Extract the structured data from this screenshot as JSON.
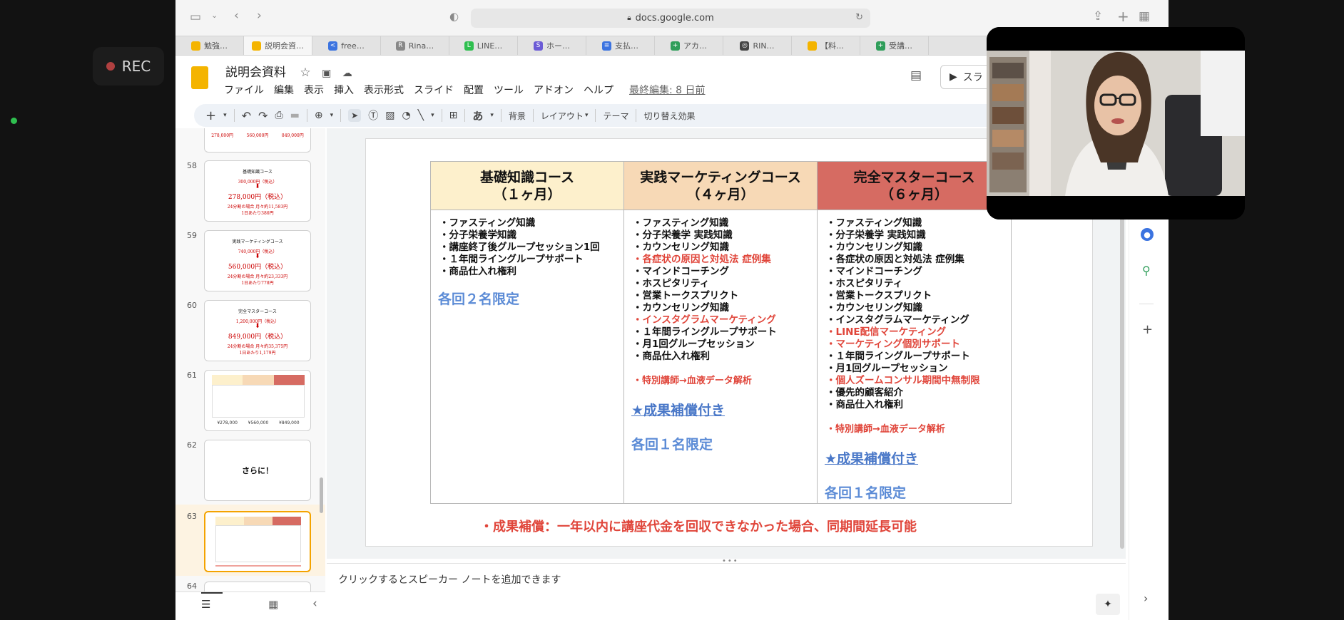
{
  "recording": {
    "label": "REC"
  },
  "browser": {
    "url": "docs.google.com",
    "tabs": [
      {
        "label": "勉強…",
        "color": "#f4b400",
        "icon": ""
      },
      {
        "label": "説明会資…",
        "color": "#f4b400",
        "icon": ""
      },
      {
        "label": "free…",
        "color": "#3b73e0",
        "icon": "<"
      },
      {
        "label": "Rina…",
        "color": "#888888",
        "icon": "R"
      },
      {
        "label": "LINE…",
        "color": "#2fbf4f",
        "icon": "L"
      },
      {
        "label": "ホー…",
        "color": "#6b5bd6",
        "icon": "S"
      },
      {
        "label": "支払…",
        "color": "#3b73e0",
        "icon": "≡"
      },
      {
        "label": "アカ…",
        "color": "#2f9e5a",
        "icon": "+"
      },
      {
        "label": "RIN…",
        "color": "#444444",
        "icon": "◎"
      },
      {
        "label": "【料…",
        "color": "#f4b400",
        "icon": ""
      },
      {
        "label": "受講…",
        "color": "#2f9e5a",
        "icon": "+"
      }
    ]
  },
  "slides": {
    "title": "説明会資料",
    "menu": [
      "ファイル",
      "編集",
      "表示",
      "挿入",
      "表示形式",
      "スライド",
      "配置",
      "ツール",
      "アドオン",
      "ヘルプ"
    ],
    "last_edit": "最終編集: 8 日前",
    "toolbar": {
      "bg": "背景",
      "layout": "レイアウト",
      "theme": "テーマ",
      "transition": "切り替え効果",
      "font_glyph": "あ"
    },
    "present_label": "スラ",
    "notes_placeholder": "クリックするとスピーカー ノートを追加できます"
  },
  "filmstrip": {
    "numbers": [
      "58",
      "59",
      "60",
      "61",
      "62",
      "63",
      "64"
    ],
    "thumb57": {
      "l1": "278,000円",
      "l2": "560,000円",
      "l3": "849,000円"
    },
    "thumb58": {
      "t": "基礎知識コース",
      "a": "300,000円（税込）",
      "b": "278,000円（税込）",
      "c": "24分割の場合 月々約11,583円",
      "d": "1日あたり386円"
    },
    "thumb59": {
      "t": "実践マーケティングコース",
      "a": "740,000円（税込）",
      "b": "560,000円（税込）",
      "c": "24分割の場合 月々約23,333円",
      "d": "1日あたり778円"
    },
    "thumb60": {
      "t": "完全マスターコース",
      "a": "1,200,000円（税込）",
      "b": "849,000円（税込）",
      "c": "24分割の場合 月々約35,375円",
      "d": "1日あたり1,179円"
    },
    "thumb61": {
      "p1": "¥278,000",
      "p2": "¥560,000",
      "p3": "¥849,000"
    },
    "thumb62": {
      "text": "さらに！"
    }
  },
  "slide": {
    "columns": [
      {
        "title": "基礎知識コース",
        "subtitle": "（１ヶ月）",
        "color": "#fdf0cc",
        "items": [
          {
            "text": "・ファスティング知識",
            "red": false
          },
          {
            "text": "・分子栄養学知識",
            "red": false
          },
          {
            "text": "・講座終了後グループセッション1回",
            "red": false
          },
          {
            "text": "・１年間ライングループサポート",
            "red": false
          },
          {
            "text": "・商品仕入れ権利",
            "red": false
          }
        ],
        "guarantee": "",
        "limit": "各回２名限定"
      },
      {
        "title": "実践マーケティングコース",
        "subtitle": "（４ヶ月）",
        "color": "#f7d9b6",
        "items": [
          {
            "text": "・ファスティング知識",
            "red": false
          },
          {
            "text": "・分子栄養学 実践知識",
            "red": false
          },
          {
            "text": "・カウンセリング知識",
            "red": false
          },
          {
            "text": "・各症状の原因と対処法 症例集",
            "red": true
          },
          {
            "text": "・マインドコーチング",
            "red": false
          },
          {
            "text": "・ホスピタリティ",
            "red": false
          },
          {
            "text": "・営業トークスプリクト",
            "red": false
          },
          {
            "text": "・カウンセリング知識",
            "red": false
          },
          {
            "text": "・インスタグラムマーケティング",
            "red": true
          },
          {
            "text": "・１年間ライングループサポート",
            "red": false
          },
          {
            "text": "・月1回グループセッション",
            "red": false
          },
          {
            "text": "・商品仕入れ権利",
            "red": false
          },
          {
            "text": "",
            "red": false
          },
          {
            "text": "・特別講師→血液データ解析",
            "red": true
          }
        ],
        "guarantee": "★成果補償付き",
        "limit": "各回１名限定"
      },
      {
        "title": "完全マスターコース",
        "subtitle": "（６ヶ月）",
        "color": "#d66b62",
        "items": [
          {
            "text": "・ファスティング知識",
            "red": false
          },
          {
            "text": "・分子栄養学 実践知識",
            "red": false
          },
          {
            "text": "・カウンセリング知識",
            "red": false
          },
          {
            "text": "・各症状の原因と対処法 症例集",
            "red": false
          },
          {
            "text": "・マインドコーチング",
            "red": false
          },
          {
            "text": "・ホスピタリティ",
            "red": false
          },
          {
            "text": "・営業トークスプリクト",
            "red": false
          },
          {
            "text": "・カウンセリング知識",
            "red": false
          },
          {
            "text": "・インスタグラムマーケティング",
            "red": false
          },
          {
            "text": "・LINE配信マーケティング",
            "red": true
          },
          {
            "text": "・マーケティング個別サポート",
            "red": true
          },
          {
            "text": "・１年間ライングループサポート",
            "red": false
          },
          {
            "text": "・月1回グループセッション",
            "red": false
          },
          {
            "text": "・個人ズームコンサル期間中無制限",
            "red": true
          },
          {
            "text": "・優先的顧客紹介",
            "red": false
          },
          {
            "text": "・商品仕入れ権利",
            "red": false
          },
          {
            "text": "",
            "red": false
          },
          {
            "text": "・特別講師→血液データ解析",
            "red": true
          }
        ],
        "guarantee": "★成果補償付き",
        "limit": "各回１名限定"
      }
    ],
    "footnote": "・成果補償：一年以内に講座代金を回収できなかった場合、同期間延長可能"
  }
}
